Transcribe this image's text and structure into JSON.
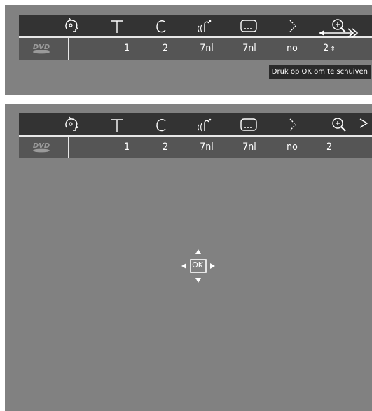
{
  "menu_top": {
    "values": [
      "1",
      "2",
      "7nl",
      "7nl",
      "no",
      "2"
    ],
    "zoom_stepper_glyph": "⇕",
    "tooltip": "Druk op OK om te schuiven"
  },
  "menu_bottom": {
    "values": [
      "1",
      "2",
      "7nl",
      "7nl",
      "no",
      "2"
    ]
  },
  "ok_pad": {
    "label": "OK"
  },
  "icons": [
    "user-profile-icon",
    "title-icon",
    "chapter-icon",
    "audio-language-icon",
    "subtitle-icon",
    "angle-icon",
    "zoom-icon",
    "dvd-disc-icon"
  ],
  "colors": {
    "icon_bar": "#333333",
    "value_bar": "#555555",
    "panel_bg": "#818181",
    "accent_line": "#e8e8e8"
  }
}
